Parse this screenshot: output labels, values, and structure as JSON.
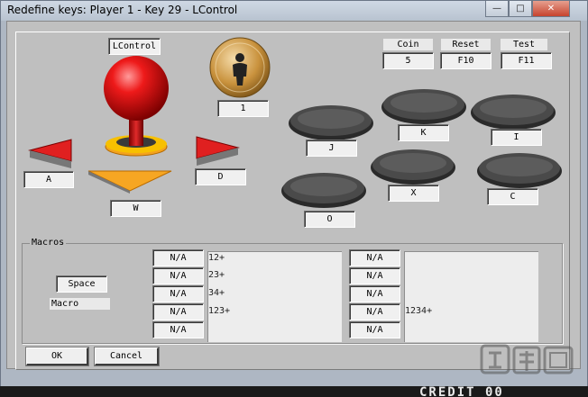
{
  "window": {
    "title": "Redefine keys: Player 1 - Key 29 - LControl"
  },
  "caption_buttons": {
    "minimize": "—",
    "maximize": "□",
    "close": "✕"
  },
  "joystick": {
    "up_label": "LControl",
    "down_label": "W",
    "left_label": "A",
    "right_label": "D"
  },
  "player_button": {
    "label": "1"
  },
  "system_keys": [
    {
      "header": "Coin",
      "value": "5"
    },
    {
      "header": "Reset",
      "value": "F10"
    },
    {
      "header": "Test",
      "value": "F11"
    }
  ],
  "action_buttons": [
    {
      "label": "J"
    },
    {
      "label": "K"
    },
    {
      "label": "I"
    },
    {
      "label": "X"
    },
    {
      "label": "C"
    },
    {
      "label": "O"
    }
  ],
  "macros": {
    "title": "Macros",
    "key_value": "Space",
    "key_label": "Macro",
    "left_slots": [
      "N/A",
      "N/A",
      "N/A",
      "N/A",
      "N/A"
    ],
    "left_list": [
      "12+",
      "23+",
      "34+",
      "123+"
    ],
    "right_slots": [
      "N/A",
      "N/A",
      "N/A",
      "N/A",
      "N/A"
    ],
    "right_list": [
      "",
      "",
      "",
      "1234+"
    ]
  },
  "dialog_buttons": {
    "ok": "OK",
    "cancel": "Cancel"
  },
  "background_game": {
    "credit_text": "CREDIT  00"
  },
  "colors": {
    "window_bg": "#aeb7c3",
    "panel_bg": "#bfbfbf",
    "ball_red": "#e01010",
    "arrow_red": "#e02020",
    "arrow_orange": "#f39c1e",
    "player_button_gold": "#c9923d",
    "action_button_dark": "#4a4a4a"
  }
}
